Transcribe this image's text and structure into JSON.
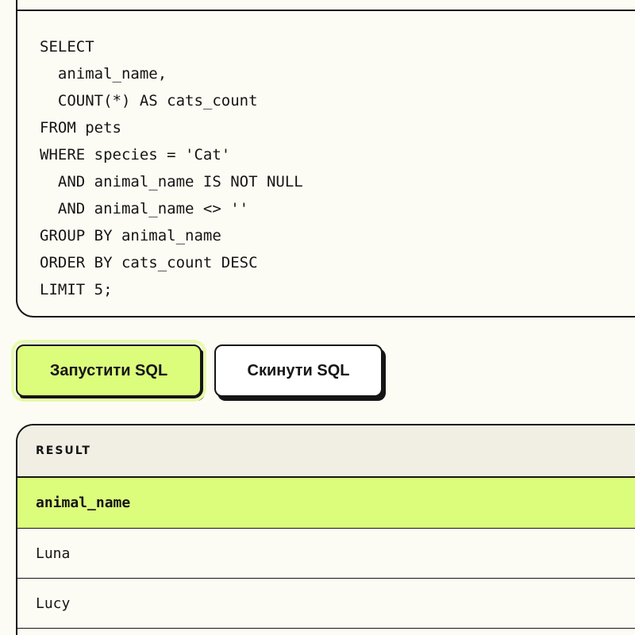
{
  "editor": {
    "lines": [
      "SELECT",
      "  animal_name,",
      "  COUNT(*) AS cats_count",
      "FROM pets",
      "WHERE species = 'Cat'",
      "  AND animal_name IS NOT NULL",
      "  AND animal_name <> ''",
      "GROUP BY animal_name",
      "ORDER BY cats_count DESC",
      "LIMIT 5;"
    ]
  },
  "toolbar": {
    "run_label": "Запустити SQL",
    "reset_label": "Скинути SQL"
  },
  "result": {
    "title": "RESULT",
    "columns": [
      "animal_name"
    ],
    "rows": [
      [
        "Luna"
      ],
      [
        "Lucy"
      ]
    ]
  },
  "colors": {
    "accent": "#dcfc7c",
    "border": "#151515",
    "background": "#fdfcf4"
  }
}
